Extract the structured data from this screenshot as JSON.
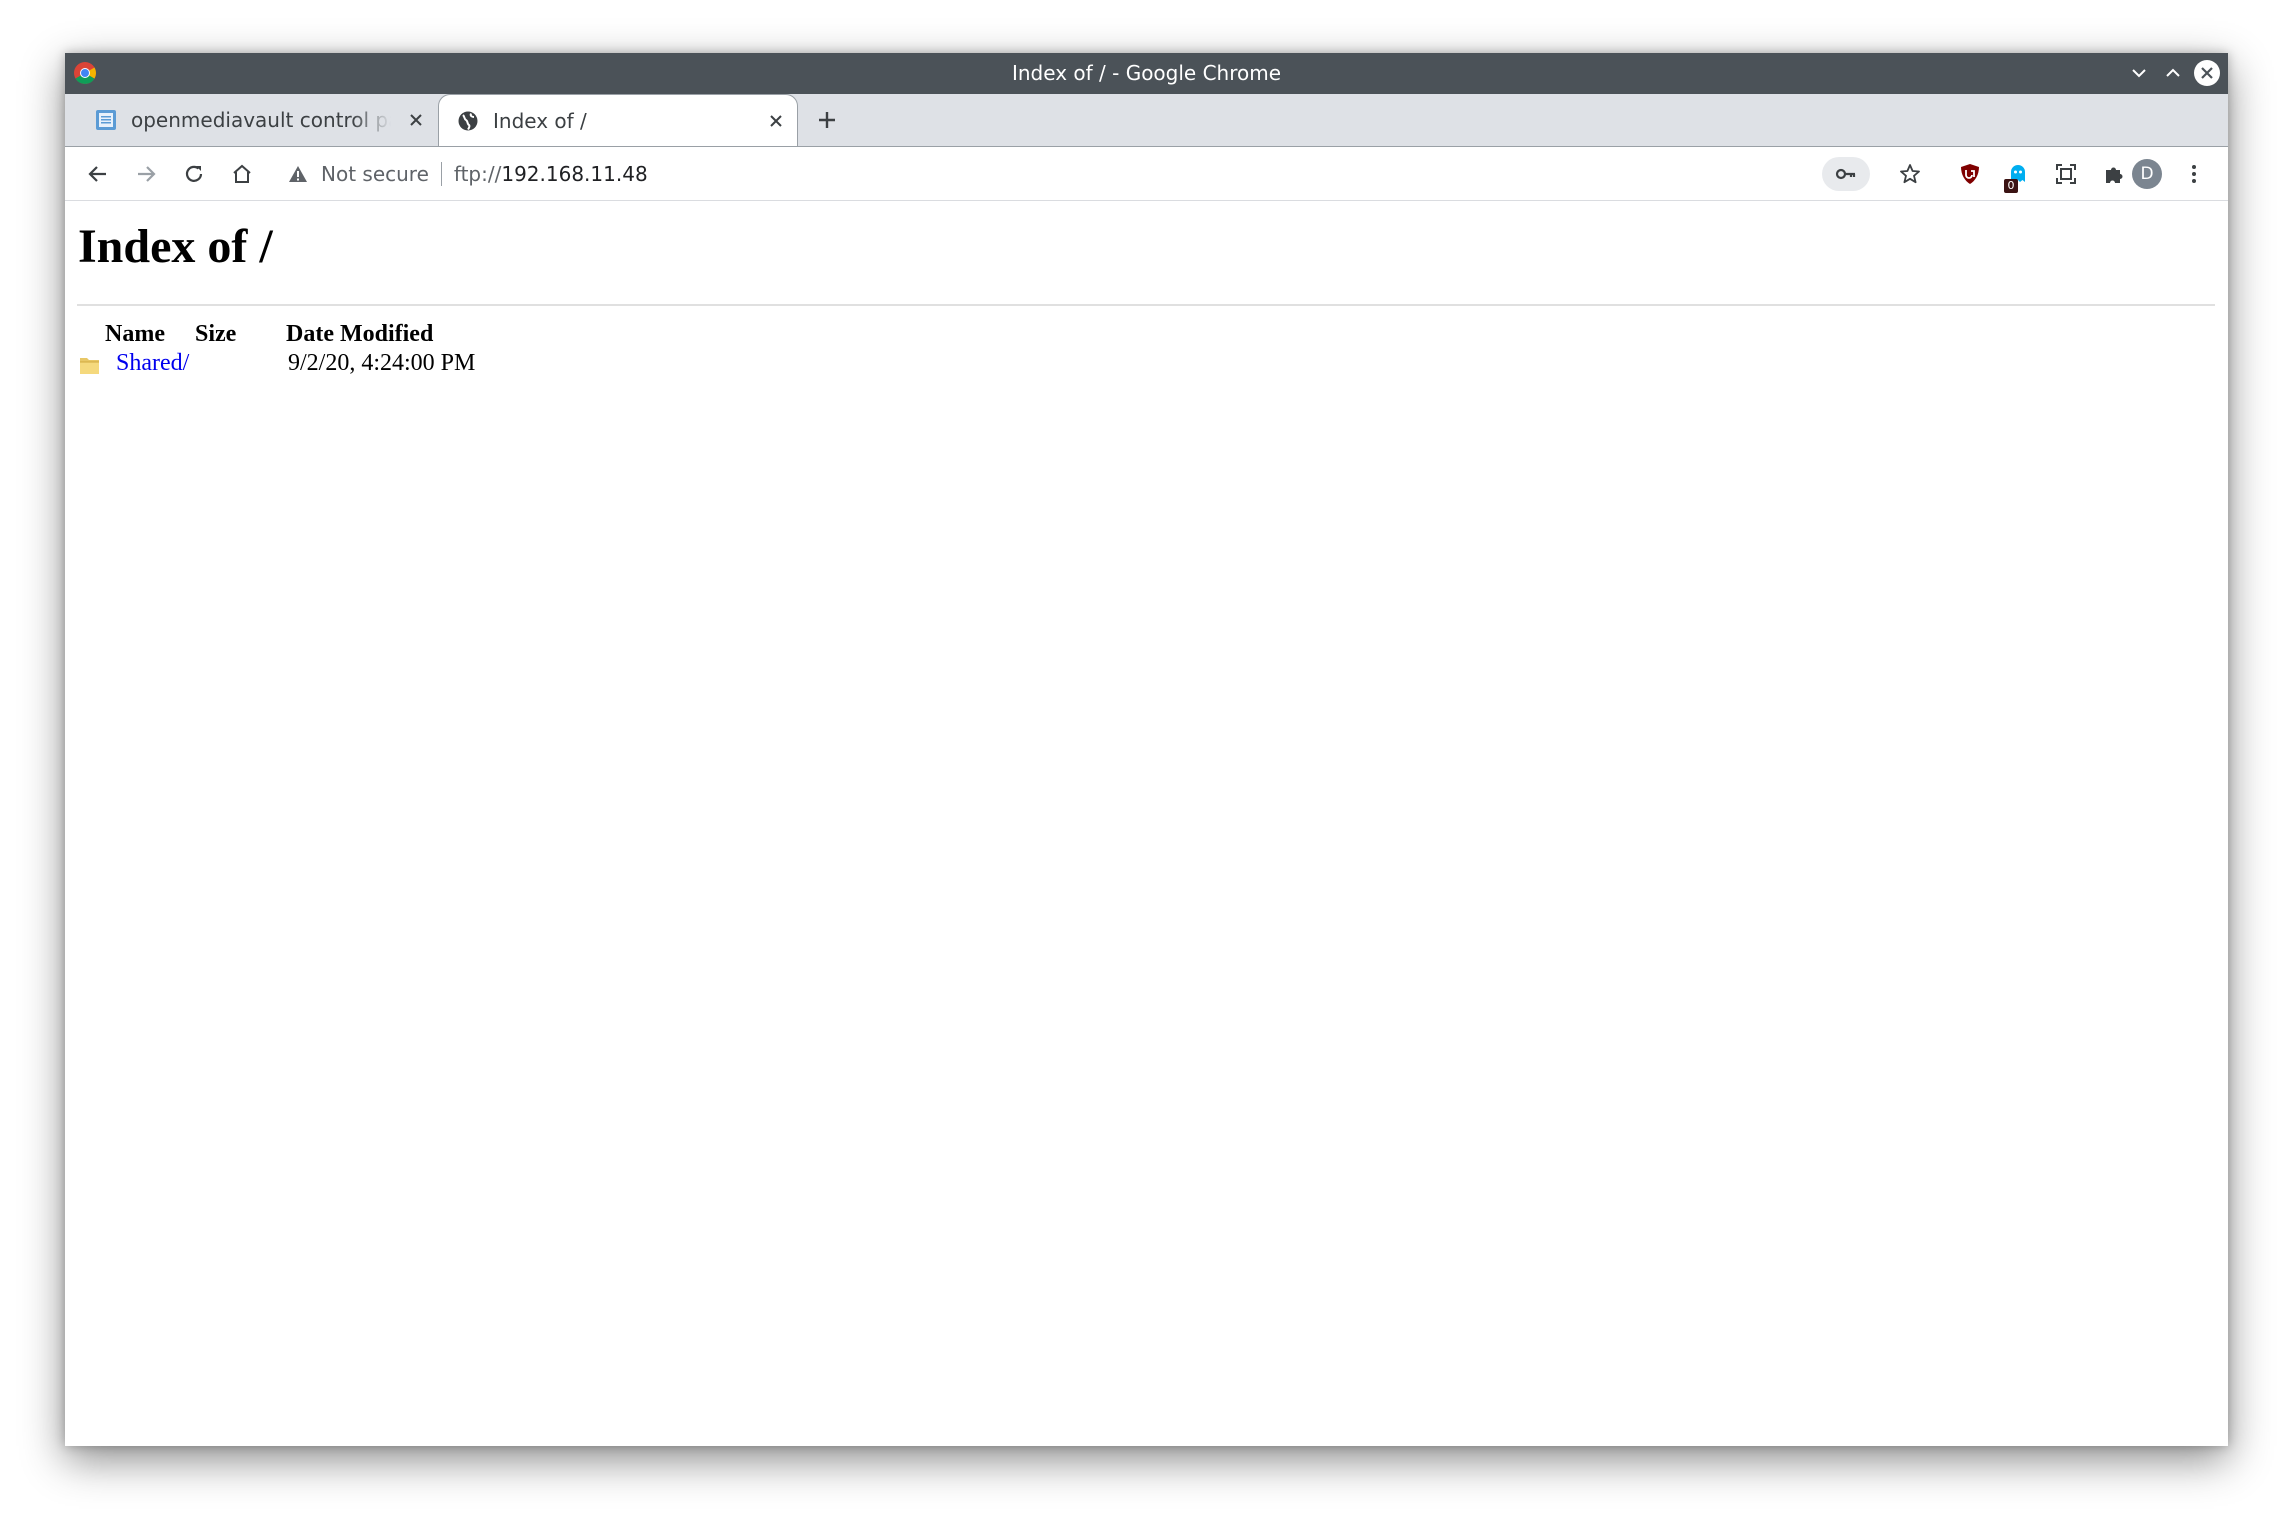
{
  "window": {
    "title": "Index of / - Google Chrome"
  },
  "tabs": [
    {
      "label": "openmediavault control panel",
      "active": false,
      "icon": "document-icon"
    },
    {
      "label": "Index of /",
      "active": true,
      "icon": "globe-icon"
    }
  ],
  "toolbar": {
    "security_label": "Not secure",
    "url_scheme": "ftp://",
    "url_host": "192.168.11.48",
    "avatar_letter": "D",
    "extension_badge": "0"
  },
  "page": {
    "heading": "Index of /",
    "columns": {
      "name": "Name",
      "size": "Size",
      "date": "Date Modified"
    },
    "entries": [
      {
        "name": "Shared/",
        "size": "",
        "date": "9/2/20, 4:24:00 PM",
        "icon": "folder-icon"
      }
    ]
  },
  "colors": {
    "titlebar": "#4b5258",
    "tabstrip": "#dee1e6",
    "link": "#0000ee",
    "ublock_red": "#800000"
  }
}
